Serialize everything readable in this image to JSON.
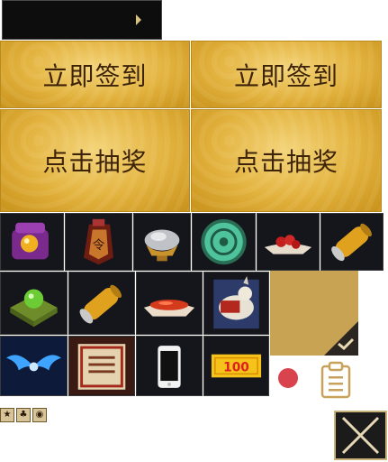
{
  "signin": {
    "left_label": "立即签到",
    "right_label": "立即签到"
  },
  "lottery": {
    "left_label": "点击抽奖",
    "right_label": "点击抽奖"
  },
  "ticket": {
    "value": "100"
  },
  "colors": {
    "gold": "#e2b23e",
    "button_text": "#3d2308",
    "red_dot": "#d8434e",
    "panel_gold": "#c9a354"
  },
  "icons": [
    "jewel-box-icon",
    "token-icon",
    "silver-ore-icon",
    "jade-disc-icon",
    "berries-plate-icon",
    "silk-roll-icon",
    "green-orb-icon",
    "silk-roll-icon",
    "chili-powder-icon",
    "horse-mount-icon",
    "blue-wings-icon",
    "scroll-icon",
    "phone-icon",
    "coupon-icon",
    "check-icon",
    "clipboard-icon",
    "close-icon"
  ]
}
